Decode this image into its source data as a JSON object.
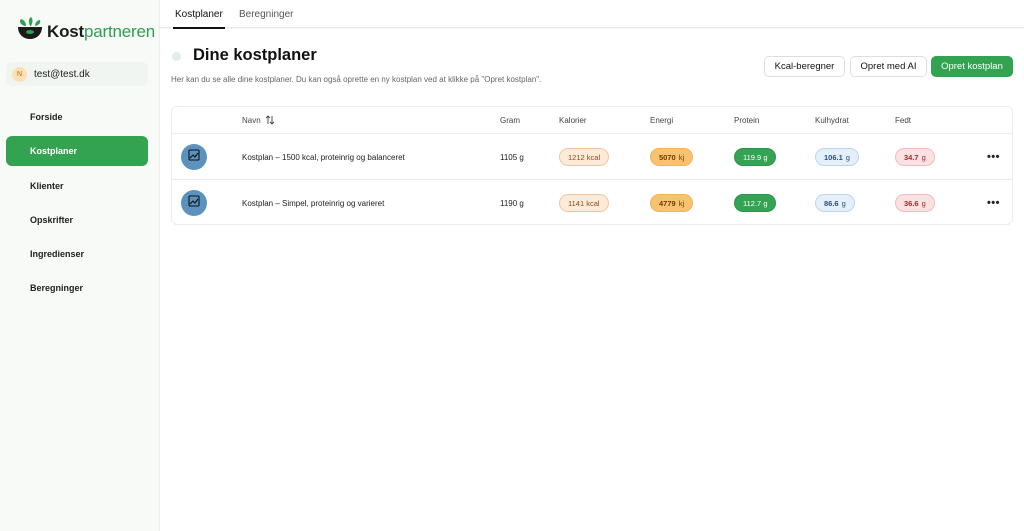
{
  "brand": {
    "name_bold": "Kost",
    "name_light": "partneren"
  },
  "user": {
    "initial": "N",
    "email": "test@test.dk"
  },
  "sidebar": {
    "items": [
      {
        "label": "Forside",
        "active": false
      },
      {
        "label": "Kostplaner",
        "active": true
      },
      {
        "label": "Klienter",
        "active": false
      },
      {
        "label": "Opskrifter",
        "active": false
      },
      {
        "label": "Ingredienser",
        "active": false
      },
      {
        "label": "Beregninger",
        "active": false
      }
    ]
  },
  "tabs": [
    {
      "label": "Kostplaner",
      "active": true
    },
    {
      "label": "Beregninger",
      "active": false
    }
  ],
  "page": {
    "title": "Dine kostplaner",
    "subtitle": "Her kan du se alle dine kostplaner. Du kan også oprette en ny kostplan ved at klikke på \"Opret kostplan\"."
  },
  "actions": {
    "kcal_label": "Kcal-beregner",
    "ai_label": "Opret med AI",
    "create_label": "Opret kostplan"
  },
  "table": {
    "headers": {
      "name": "Navn",
      "gram": "Gram",
      "kalorier": "Kalorier",
      "energi": "Energi",
      "protein": "Protein",
      "kulhydrat": "Kulhydrat",
      "fedt": "Fedt"
    },
    "rows": [
      {
        "name": "Kostplan – 1500 kcal, proteinrig og balanceret",
        "gram": "1105 g",
        "kalorier": {
          "value": "1212",
          "unit": "kcal"
        },
        "energi": {
          "value": "5070",
          "unit": "kj"
        },
        "protein": {
          "value": "119.9",
          "unit": "g"
        },
        "kulhydrat": {
          "value": "106.1",
          "unit": "g"
        },
        "fedt": {
          "value": "34.7",
          "unit": "g"
        }
      },
      {
        "name": "Kostplan – Simpel, proteinrig og varieret",
        "gram": "1190 g",
        "kalorier": {
          "value": "1141",
          "unit": "kcal"
        },
        "energi": {
          "value": "4779",
          "unit": "kj"
        },
        "protein": {
          "value": "112.7",
          "unit": "g"
        },
        "kulhydrat": {
          "value": "86.6",
          "unit": "g"
        },
        "fedt": {
          "value": "36.6",
          "unit": "g"
        }
      }
    ]
  },
  "more_glyph": "•••",
  "colors": {
    "accent": "#33a352",
    "thumb": "#5b93be"
  }
}
